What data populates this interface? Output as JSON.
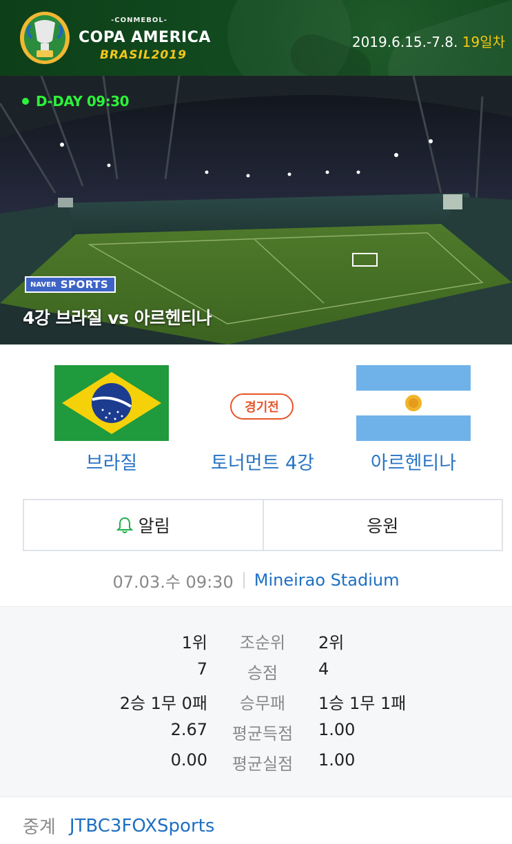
{
  "header": {
    "org": "-CONMEBOL-",
    "title": "COPA AMERICA",
    "subtitle": "BRASIL2019",
    "date_range": "2019.6.15.-7.8.",
    "day_count": "19일차"
  },
  "hero": {
    "dday": "D-DAY 09:30",
    "badge_naver": "NAVER",
    "badge_sports": "SPORTS",
    "match_title": "4강 브라질 vs 아르헨티나"
  },
  "match": {
    "home_team": "브라질",
    "away_team": "아르헨티나",
    "status": "경기전",
    "round": "토너먼트 4강"
  },
  "actions": {
    "alarm_label": "알림",
    "cheer_label": "응원"
  },
  "info": {
    "datetime": "07.03.수 09:30",
    "stadium": "Mineirao Stadium"
  },
  "stats": [
    {
      "home": "1위",
      "label": "조순위",
      "away": "2위"
    },
    {
      "home": "7",
      "label": "승점",
      "away": "4"
    },
    {
      "home": "2승 1무 0패",
      "label": "승무패",
      "away": "1승 1무 1패"
    },
    {
      "home": "2.67",
      "label": "평균득점",
      "away": "1.00"
    },
    {
      "home": "0.00",
      "label": "평균실점",
      "away": "1.00"
    }
  ],
  "broadcast": {
    "label": "중계",
    "channels": "JTBC3FOXSports"
  },
  "colors": {
    "accent_blue": "#2874c4",
    "status_orange": "#e8542a",
    "dday_green": "#2df13a",
    "day_yellow": "#f7c90f"
  },
  "icons": {
    "alarm": "bell-icon",
    "trophy": "trophy-logo"
  }
}
